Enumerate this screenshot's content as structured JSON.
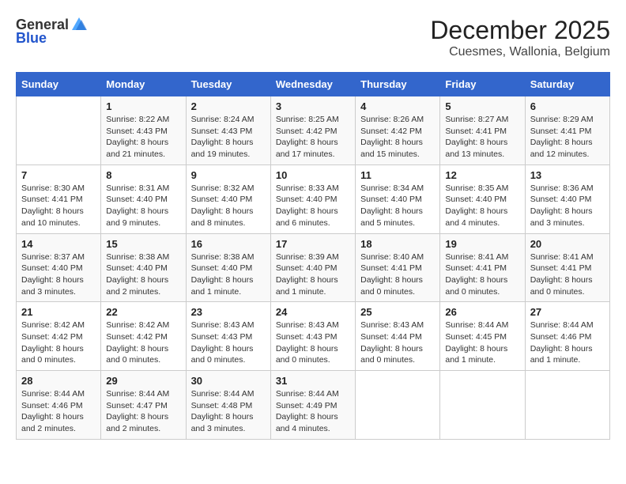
{
  "logo": {
    "text_general": "General",
    "text_blue": "Blue"
  },
  "header": {
    "month": "December 2025",
    "location": "Cuesmes, Wallonia, Belgium"
  },
  "weekdays": [
    "Sunday",
    "Monday",
    "Tuesday",
    "Wednesday",
    "Thursday",
    "Friday",
    "Saturday"
  ],
  "weeks": [
    [
      {
        "day": "",
        "sunrise": "",
        "sunset": "",
        "daylight": ""
      },
      {
        "day": "1",
        "sunrise": "Sunrise: 8:22 AM",
        "sunset": "Sunset: 4:43 PM",
        "daylight": "Daylight: 8 hours and 21 minutes."
      },
      {
        "day": "2",
        "sunrise": "Sunrise: 8:24 AM",
        "sunset": "Sunset: 4:43 PM",
        "daylight": "Daylight: 8 hours and 19 minutes."
      },
      {
        "day": "3",
        "sunrise": "Sunrise: 8:25 AM",
        "sunset": "Sunset: 4:42 PM",
        "daylight": "Daylight: 8 hours and 17 minutes."
      },
      {
        "day": "4",
        "sunrise": "Sunrise: 8:26 AM",
        "sunset": "Sunset: 4:42 PM",
        "daylight": "Daylight: 8 hours and 15 minutes."
      },
      {
        "day": "5",
        "sunrise": "Sunrise: 8:27 AM",
        "sunset": "Sunset: 4:41 PM",
        "daylight": "Daylight: 8 hours and 13 minutes."
      },
      {
        "day": "6",
        "sunrise": "Sunrise: 8:29 AM",
        "sunset": "Sunset: 4:41 PM",
        "daylight": "Daylight: 8 hours and 12 minutes."
      }
    ],
    [
      {
        "day": "7",
        "sunrise": "Sunrise: 8:30 AM",
        "sunset": "Sunset: 4:41 PM",
        "daylight": "Daylight: 8 hours and 10 minutes."
      },
      {
        "day": "8",
        "sunrise": "Sunrise: 8:31 AM",
        "sunset": "Sunset: 4:40 PM",
        "daylight": "Daylight: 8 hours and 9 minutes."
      },
      {
        "day": "9",
        "sunrise": "Sunrise: 8:32 AM",
        "sunset": "Sunset: 4:40 PM",
        "daylight": "Daylight: 8 hours and 8 minutes."
      },
      {
        "day": "10",
        "sunrise": "Sunrise: 8:33 AM",
        "sunset": "Sunset: 4:40 PM",
        "daylight": "Daylight: 8 hours and 6 minutes."
      },
      {
        "day": "11",
        "sunrise": "Sunrise: 8:34 AM",
        "sunset": "Sunset: 4:40 PM",
        "daylight": "Daylight: 8 hours and 5 minutes."
      },
      {
        "day": "12",
        "sunrise": "Sunrise: 8:35 AM",
        "sunset": "Sunset: 4:40 PM",
        "daylight": "Daylight: 8 hours and 4 minutes."
      },
      {
        "day": "13",
        "sunrise": "Sunrise: 8:36 AM",
        "sunset": "Sunset: 4:40 PM",
        "daylight": "Daylight: 8 hours and 3 minutes."
      }
    ],
    [
      {
        "day": "14",
        "sunrise": "Sunrise: 8:37 AM",
        "sunset": "Sunset: 4:40 PM",
        "daylight": "Daylight: 8 hours and 3 minutes."
      },
      {
        "day": "15",
        "sunrise": "Sunrise: 8:38 AM",
        "sunset": "Sunset: 4:40 PM",
        "daylight": "Daylight: 8 hours and 2 minutes."
      },
      {
        "day": "16",
        "sunrise": "Sunrise: 8:38 AM",
        "sunset": "Sunset: 4:40 PM",
        "daylight": "Daylight: 8 hours and 1 minute."
      },
      {
        "day": "17",
        "sunrise": "Sunrise: 8:39 AM",
        "sunset": "Sunset: 4:40 PM",
        "daylight": "Daylight: 8 hours and 1 minute."
      },
      {
        "day": "18",
        "sunrise": "Sunrise: 8:40 AM",
        "sunset": "Sunset: 4:41 PM",
        "daylight": "Daylight: 8 hours and 0 minutes."
      },
      {
        "day": "19",
        "sunrise": "Sunrise: 8:41 AM",
        "sunset": "Sunset: 4:41 PM",
        "daylight": "Daylight: 8 hours and 0 minutes."
      },
      {
        "day": "20",
        "sunrise": "Sunrise: 8:41 AM",
        "sunset": "Sunset: 4:41 PM",
        "daylight": "Daylight: 8 hours and 0 minutes."
      }
    ],
    [
      {
        "day": "21",
        "sunrise": "Sunrise: 8:42 AM",
        "sunset": "Sunset: 4:42 PM",
        "daylight": "Daylight: 8 hours and 0 minutes."
      },
      {
        "day": "22",
        "sunrise": "Sunrise: 8:42 AM",
        "sunset": "Sunset: 4:42 PM",
        "daylight": "Daylight: 8 hours and 0 minutes."
      },
      {
        "day": "23",
        "sunrise": "Sunrise: 8:43 AM",
        "sunset": "Sunset: 4:43 PM",
        "daylight": "Daylight: 8 hours and 0 minutes."
      },
      {
        "day": "24",
        "sunrise": "Sunrise: 8:43 AM",
        "sunset": "Sunset: 4:43 PM",
        "daylight": "Daylight: 8 hours and 0 minutes."
      },
      {
        "day": "25",
        "sunrise": "Sunrise: 8:43 AM",
        "sunset": "Sunset: 4:44 PM",
        "daylight": "Daylight: 8 hours and 0 minutes."
      },
      {
        "day": "26",
        "sunrise": "Sunrise: 8:44 AM",
        "sunset": "Sunset: 4:45 PM",
        "daylight": "Daylight: 8 hours and 1 minute."
      },
      {
        "day": "27",
        "sunrise": "Sunrise: 8:44 AM",
        "sunset": "Sunset: 4:46 PM",
        "daylight": "Daylight: 8 hours and 1 minute."
      }
    ],
    [
      {
        "day": "28",
        "sunrise": "Sunrise: 8:44 AM",
        "sunset": "Sunset: 4:46 PM",
        "daylight": "Daylight: 8 hours and 2 minutes."
      },
      {
        "day": "29",
        "sunrise": "Sunrise: 8:44 AM",
        "sunset": "Sunset: 4:47 PM",
        "daylight": "Daylight: 8 hours and 2 minutes."
      },
      {
        "day": "30",
        "sunrise": "Sunrise: 8:44 AM",
        "sunset": "Sunset: 4:48 PM",
        "daylight": "Daylight: 8 hours and 3 minutes."
      },
      {
        "day": "31",
        "sunrise": "Sunrise: 8:44 AM",
        "sunset": "Sunset: 4:49 PM",
        "daylight": "Daylight: 8 hours and 4 minutes."
      },
      {
        "day": "",
        "sunrise": "",
        "sunset": "",
        "daylight": ""
      },
      {
        "day": "",
        "sunrise": "",
        "sunset": "",
        "daylight": ""
      },
      {
        "day": "",
        "sunrise": "",
        "sunset": "",
        "daylight": ""
      }
    ]
  ]
}
